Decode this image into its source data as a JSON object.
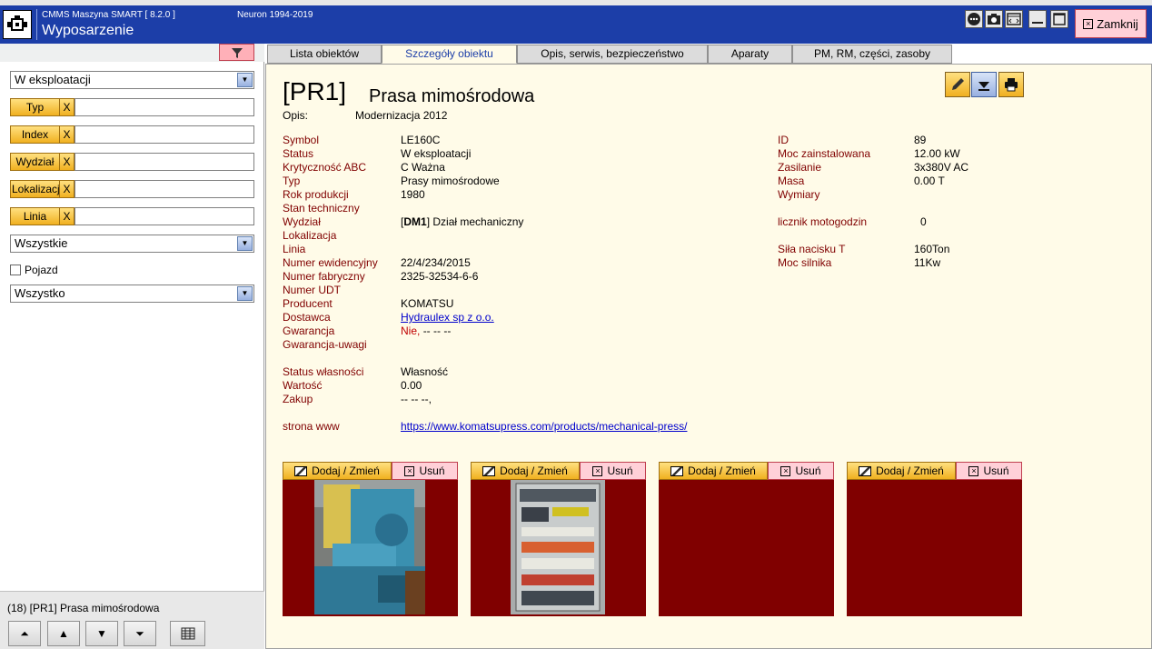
{
  "app": {
    "name": "CMMS Maszyna SMART  [  8.2.0 ]",
    "company": "Neuron 1994-2019",
    "module": "Wyposarzenie",
    "close_label": "Zamknij"
  },
  "left": {
    "status_filter": "W eksploatacji",
    "filters": [
      {
        "label": "Typ",
        "x": "X",
        "value": ""
      },
      {
        "label": "Index",
        "x": "X",
        "value": ""
      },
      {
        "label": "Wydział",
        "x": "X",
        "value": ""
      },
      {
        "label": "Lokalizacja",
        "x": "X",
        "value": ""
      },
      {
        "label": "Linia",
        "x": "X",
        "value": ""
      }
    ],
    "dropdown2": "Wszystkie",
    "pojazd_label": "Pojazd",
    "dropdown3": "Wszystko",
    "selected": "(18)  [PR1]  Prasa mimośrodowa"
  },
  "tabs": [
    "Lista obiektów",
    "Szczegóły obiektu",
    "Opis, serwis, bezpieczeństwo",
    "Aparaty",
    "PM, RM, części, zasoby"
  ],
  "object": {
    "code": "[PR1]",
    "name": "Prasa mimośrodowa",
    "desc_label": "Opis:",
    "desc_value": "Modernizacja 2012"
  },
  "fields_left": [
    {
      "label": "Symbol",
      "value": "LE160C"
    },
    {
      "label": "Status",
      "value": "W eksploatacji"
    },
    {
      "label": "Krytyczność ABC",
      "value": "C  Ważna"
    },
    {
      "label": "Typ",
      "value": "Prasy mimośrodowe"
    },
    {
      "label": "Rok produkcji",
      "value": "1980"
    },
    {
      "label": "Stan techniczny",
      "value": ""
    },
    {
      "label": "Wydział",
      "value_bold": "DM1",
      "value": "Dział mechaniczny"
    },
    {
      "label": "Lokalizacja",
      "value": ""
    },
    {
      "label": "Linia",
      "value": ""
    },
    {
      "label": "Numer ewidencyjny",
      "value": "22/4/234/2015"
    },
    {
      "label": "Numer fabryczny",
      "value": "2325-32534-6-6"
    },
    {
      "label": "Numer UDT",
      "value": ""
    },
    {
      "label": "Producent",
      "value": "KOMATSU"
    },
    {
      "label": "Dostawca",
      "value": "Hydraulex sp z o.o."
    },
    {
      "label": "Gwarancja",
      "value_red": "Nie,",
      "value": "-- -- --"
    },
    {
      "label": "Gwarancja-uwagi",
      "value": ""
    }
  ],
  "fields_owner": [
    {
      "label": "Status własności",
      "value": "Własność"
    },
    {
      "label": "Wartość",
      "value": "0.00"
    },
    {
      "label": "Zakup",
      "value": "-- -- --,"
    }
  ],
  "www": {
    "label": "strona www",
    "value": "https://www.komatsupress.com/products/mechanical-press/"
  },
  "fields_right": [
    {
      "label": "ID",
      "value": "89"
    },
    {
      "label": "Moc zainstalowana",
      "value": "12.00 kW"
    },
    {
      "label": "Zasilanie",
      "value": "3x380V AC"
    },
    {
      "label": "Masa",
      "value": "0.00 T"
    },
    {
      "label": "Wymiary",
      "value": ""
    },
    {
      "label": "licznik motogodzin",
      "value": "0"
    },
    {
      "label": "Siła nacisku T",
      "value": "160Ton"
    },
    {
      "label": "Moc silnika",
      "value": "11Kw"
    }
  ],
  "photos": {
    "add_label": "Dodaj / Zmień",
    "del_label": "Usuń"
  }
}
